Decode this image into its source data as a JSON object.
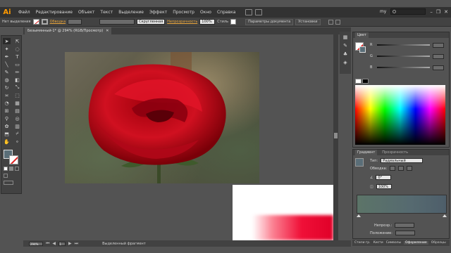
{
  "app": {
    "logo": "Ai",
    "menu": [
      "Файл",
      "Редактирование",
      "Объект",
      "Текст",
      "Выделение",
      "Эффект",
      "Просмотр",
      "Окно",
      "Справка"
    ],
    "workspace": "my",
    "win_controls": [
      "–",
      "❐",
      "✕"
    ]
  },
  "control_bar": {
    "selection_state": "Нет выделения",
    "stroke_label": "Обводка",
    "brush_label": "Скругленная",
    "opacity_label": "Непрозрачность",
    "opacity_value": "100%",
    "style_label": "Стиль",
    "doc_settings": "Параметры документа",
    "preferences": "Установки"
  },
  "document": {
    "tab_title": "Безымянный-1* @ 294% (RGB/Просмотр)",
    "tab_close": "✕"
  },
  "status_bar": {
    "zoom": "294%",
    "page": "1",
    "tool_label": "Выделенный фрагмент"
  },
  "color_panel": {
    "tabs": [
      "Цвет"
    ],
    "channels": [
      "R",
      "G",
      "B"
    ]
  },
  "gradient_panel": {
    "tabs": [
      "Градиент",
      "Прозрачность"
    ],
    "type_label": "Тип:",
    "type_value": "Радиальный",
    "stroke_label": "Обводка:",
    "angle_value": "0°",
    "aspect_value": "100%",
    "opacity_label": "Непрозр.:",
    "location_label": "Положение:"
  },
  "bottom_tabs": [
    "Стили гр.",
    "Кисти",
    "Символы",
    "Оформление",
    "Образцы"
  ],
  "colors": {
    "menu_bg": "#323232",
    "panel_bg": "#535353",
    "accent_orange": "#ff9a00",
    "rose_red": "#d0101e"
  }
}
